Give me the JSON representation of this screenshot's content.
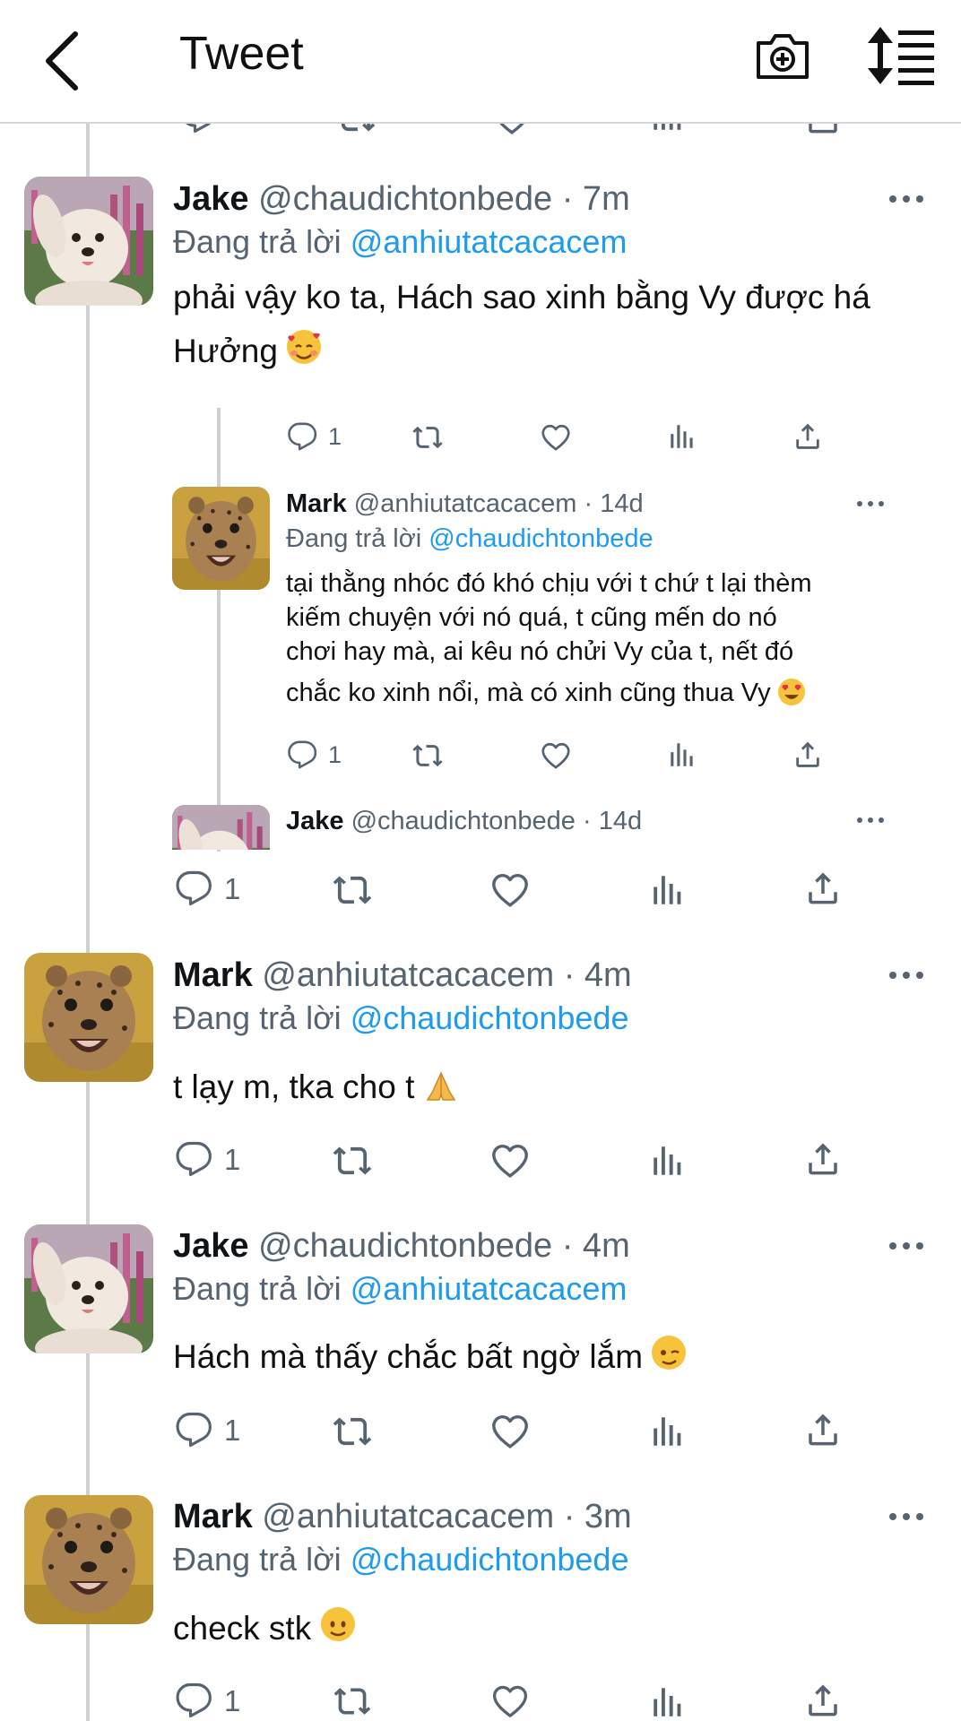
{
  "header": {
    "title": "Tweet",
    "back_icon": "chevron-left-icon",
    "camera_icon": "camera-icon",
    "sort_icon": "sort-icon"
  },
  "colors": {
    "link": "#1d9bf0",
    "secondary": "#566370",
    "divider": "#d6d6d6"
  },
  "tweets": [
    {
      "name": "Jake",
      "handle": "@chaudichtonbede",
      "time": "· 7m",
      "reply_prefix": "Đang trả lời ",
      "reply_to": "@anhiutatcacacem",
      "text": "phải vậy ko ta, Hách sao xinh bằng Vy được há Hưởng",
      "emoji": "smiling-face-with-hearts",
      "reply_count": "1",
      "replies": [
        {
          "name": "Mark",
          "handle": "@anhiutatcacacem",
          "time": "· 14d",
          "reply_prefix": "Đang trả lời ",
          "reply_to": "@chaudichtonbede",
          "text_lines": [
            "tại thằng nhóc đó khó chịu với t chứ t lại thèm",
            "kiếm chuyện với nó quá, t cũng mến do nó",
            "chơi hay mà, ai kêu nó chửi Vy của t, nết đó",
            "chắc ko xinh nổi, mà có xinh cũng thua Vy"
          ],
          "emoji": "heart-eyes",
          "reply_count": "1"
        },
        {
          "name": "Jake",
          "handle": "@chaudichtonbede",
          "time": "· 14d"
        }
      ],
      "footer_reply_count": "1"
    },
    {
      "name": "Mark",
      "handle": "@anhiutatcacacem",
      "time": "· 4m",
      "reply_prefix": "Đang trả lời ",
      "reply_to": "@chaudichtonbede",
      "text": "t lạy m, tka cho t",
      "emoji": "folded-hands",
      "reply_count": "1"
    },
    {
      "name": "Jake",
      "handle": "@chaudichtonbede",
      "time": "· 4m",
      "reply_prefix": "Đang trả lời ",
      "reply_to": "@anhiutatcacacem",
      "text": "Hách mà thấy chắc bất ngờ lắm",
      "emoji": "winking-face",
      "reply_count": "1"
    },
    {
      "name": "Mark",
      "handle": "@anhiutatcacacem",
      "time": "· 3m",
      "reply_prefix": "Đang trả lời ",
      "reply_to": "@chaudichtonbede",
      "text": "check stk",
      "emoji": "slightly-smiling-face",
      "reply_count": "1"
    }
  ]
}
